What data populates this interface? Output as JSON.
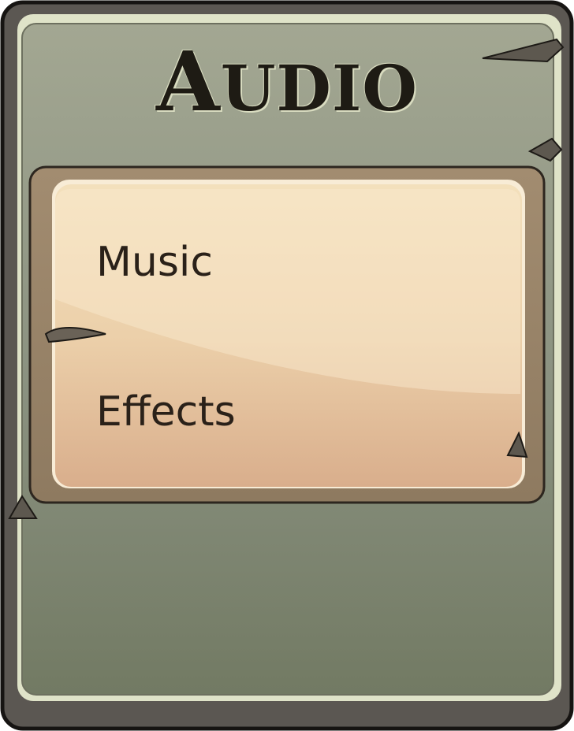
{
  "panel": {
    "title": "Audio",
    "title_initial": "A",
    "title_rest": "UDIO"
  },
  "menu": {
    "items": [
      {
        "label": "Music"
      },
      {
        "label": "Effects"
      }
    ]
  },
  "colors": {
    "frame_outer": "#5a5651",
    "panel_fill": "#8f9881",
    "parchment_top": "#f1dcb5",
    "parchment_bottom": "#dcb08e",
    "text_dark": "#2a2119"
  }
}
